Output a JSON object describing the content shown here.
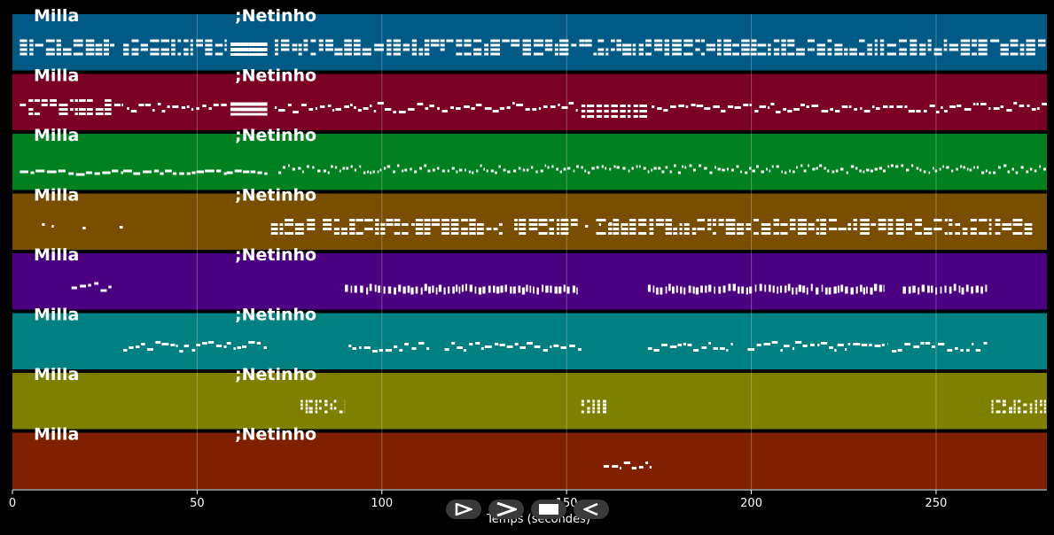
{
  "chart_data": {
    "type": "piano-roll",
    "title": "",
    "xlabel": "Temps (secondes)",
    "ylabel": "",
    "xlim": [
      0,
      280
    ],
    "xticks": [
      0,
      50,
      100,
      150,
      200,
      250
    ],
    "grid": true,
    "tracks": [
      {
        "label_left": "Milla",
        "label_right": ";Netinho",
        "color": "#005a85",
        "segments": [
          [
            2,
            28,
            "dense_chords"
          ],
          [
            30,
            58,
            "dense_chords"
          ],
          [
            59,
            64,
            "block"
          ],
          [
            64,
            69,
            "block"
          ],
          [
            71,
            110,
            "dense_chords"
          ],
          [
            110,
            155,
            "dense_chords"
          ],
          [
            155,
            200,
            "dense_chords"
          ],
          [
            200,
            240,
            "dense_chords"
          ],
          [
            240,
            280,
            "dense_chords"
          ]
        ]
      },
      {
        "label_left": "Milla",
        "label_right": ";Netinho",
        "color": "#7a0026",
        "segments": [
          [
            2,
            30,
            "dense_chords"
          ],
          [
            31,
            58,
            "melody"
          ],
          [
            59,
            69,
            "block"
          ],
          [
            71,
            153,
            "melody"
          ],
          [
            154,
            172,
            "low_chords"
          ],
          [
            173,
            280,
            "melody"
          ]
        ]
      },
      {
        "label_left": "Milla",
        "label_right": ";Netinho",
        "color": "#00801f",
        "segments": [
          [
            2,
            30,
            "bass"
          ],
          [
            30,
            58,
            "bass"
          ],
          [
            58,
            69,
            "bass"
          ],
          [
            72,
            280,
            "fine"
          ]
        ]
      },
      {
        "label_left": "Milla",
        "label_right": ";Netinho",
        "color": "#7a4e00",
        "segments": [
          [
            8,
            12,
            "sparse"
          ],
          [
            19,
            22,
            "sparse"
          ],
          [
            29,
            31,
            "sparse"
          ],
          [
            70,
            82,
            "dense_chords"
          ],
          [
            84,
            153,
            "dense_chords"
          ],
          [
            155,
            165,
            "sparse"
          ],
          [
            158,
            265,
            "dense_chords"
          ],
          [
            266,
            276,
            "dense_chords"
          ]
        ]
      },
      {
        "label_left": "Milla",
        "label_right": ";Netinho",
        "color": "#4b0082",
        "segments": [
          [
            16,
            27,
            "melody"
          ],
          [
            90,
            153,
            "ticks"
          ],
          [
            172,
            236,
            "ticks"
          ],
          [
            241,
            264,
            "ticks"
          ]
        ]
      },
      {
        "label_left": "Milla",
        "label_right": ";Netinho",
        "color": "#008080",
        "segments": [
          [
            30,
            58,
            "melody"
          ],
          [
            58,
            69,
            "melody"
          ],
          [
            91,
            113,
            "melody"
          ],
          [
            117,
            154,
            "melody"
          ],
          [
            172,
            195,
            "melody"
          ],
          [
            199,
            237,
            "melody"
          ],
          [
            238,
            264,
            "melody"
          ]
        ]
      },
      {
        "label_left": "Milla",
        "label_right": ";Netinho",
        "color": "#808000",
        "segments": [
          [
            78,
            90,
            "chords_small"
          ],
          [
            154,
            161,
            "chords_small"
          ],
          [
            265,
            280,
            "chords_small"
          ]
        ]
      },
      {
        "label_left": "Milla",
        "label_right": ";Netinho",
        "color": "#802000",
        "segments": [
          [
            160,
            173,
            "melody"
          ]
        ]
      }
    ]
  },
  "controls": [
    {
      "name": "play",
      "icon": "play-icon"
    },
    {
      "name": "forward",
      "icon": "chevron-right-icon"
    },
    {
      "name": "stop",
      "icon": "stop-icon"
    },
    {
      "name": "back",
      "icon": "triangle-left-icon"
    }
  ]
}
